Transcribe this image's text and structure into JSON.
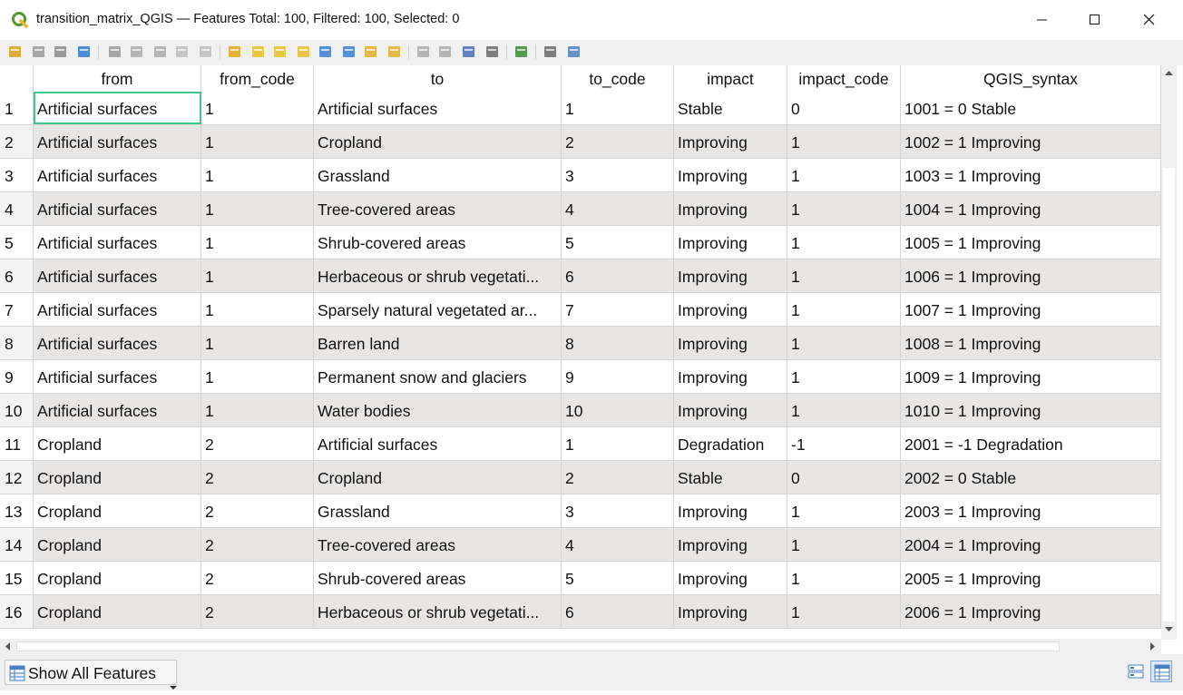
{
  "window": {
    "title": "transition_matrix_QGIS — Features Total: 100, Filtered: 100, Selected: 0",
    "app_icon": "qgis-logo-icon",
    "controls": [
      "minimize-icon",
      "maximize-icon",
      "close-icon"
    ]
  },
  "toolbar": {
    "icons": [
      "toggle-editing-icon",
      "toggle-multi-edit-icon",
      "save-edits-icon",
      "reload-table-icon",
      "add-feature-icon",
      "delete-selected-icon",
      "cut-icon",
      "copy-icon",
      "paste-icon",
      "expression-select-icon",
      "select-all-icon",
      "invert-selection-icon",
      "deselect-all-icon",
      "filter-select-icon",
      "move-selection-to-top-icon",
      "pan-to-selected-icon",
      "zoom-to-selected-icon",
      "new-field-icon",
      "delete-field-icon",
      "field-calculator-icon",
      "conditional-formatting-icon",
      "dock-table-icon",
      "actions-icon",
      "zoom-to-feature-icon"
    ]
  },
  "table": {
    "columns": [
      "from",
      "from_code",
      "to",
      "to_code",
      "impact",
      "impact_code",
      "QGIS_syntax"
    ],
    "rows": [
      {
        "n": "1",
        "from": "Artificial surfaces",
        "from_code": "1",
        "to": "Artificial surfaces",
        "to_code": "1",
        "impact": "Stable",
        "impact_code": "0",
        "syntax": "1001 = 0 Stable"
      },
      {
        "n": "2",
        "from": "Artificial surfaces",
        "from_code": "1",
        "to": "Cropland",
        "to_code": "2",
        "impact": "Improving",
        "impact_code": "1",
        "syntax": "1002 = 1 Improving"
      },
      {
        "n": "3",
        "from": "Artificial surfaces",
        "from_code": "1",
        "to": "Grassland",
        "to_code": "3",
        "impact": "Improving",
        "impact_code": "1",
        "syntax": "1003 = 1 Improving"
      },
      {
        "n": "4",
        "from": "Artificial surfaces",
        "from_code": "1",
        "to": "Tree-covered areas",
        "to_code": "4",
        "impact": "Improving",
        "impact_code": "1",
        "syntax": "1004 = 1 Improving"
      },
      {
        "n": "5",
        "from": "Artificial surfaces",
        "from_code": "1",
        "to": "Shrub-covered areas",
        "to_code": "5",
        "impact": "Improving",
        "impact_code": "1",
        "syntax": "1005 = 1 Improving"
      },
      {
        "n": "6",
        "from": "Artificial surfaces",
        "from_code": "1",
        "to": "Herbaceous or shrub vegetati...",
        "to_code": "6",
        "impact": "Improving",
        "impact_code": "1",
        "syntax": "1006 = 1 Improving"
      },
      {
        "n": "7",
        "from": "Artificial surfaces",
        "from_code": "1",
        "to": "Sparsely natural vegetated ar...",
        "to_code": "7",
        "impact": "Improving",
        "impact_code": "1",
        "syntax": "1007 = 1 Improving"
      },
      {
        "n": "8",
        "from": "Artificial surfaces",
        "from_code": "1",
        "to": "Barren land",
        "to_code": "8",
        "impact": "Improving",
        "impact_code": "1",
        "syntax": "1008 = 1 Improving"
      },
      {
        "n": "9",
        "from": "Artificial surfaces",
        "from_code": "1",
        "to": "Permanent snow and glaciers",
        "to_code": "9",
        "impact": "Improving",
        "impact_code": "1",
        "syntax": "1009 = 1 Improving"
      },
      {
        "n": "10",
        "from": "Artificial surfaces",
        "from_code": "1",
        "to": "Water bodies",
        "to_code": "10",
        "impact": "Improving",
        "impact_code": "1",
        "syntax": "1010 = 1 Improving"
      },
      {
        "n": "11",
        "from": "Cropland",
        "from_code": "2",
        "to": "Artificial surfaces",
        "to_code": "1",
        "impact": "Degradation",
        "impact_code": "-1",
        "syntax": "2001 = -1 Degradation"
      },
      {
        "n": "12",
        "from": "Cropland",
        "from_code": "2",
        "to": "Cropland",
        "to_code": "2",
        "impact": "Stable",
        "impact_code": "0",
        "syntax": "2002 = 0 Stable"
      },
      {
        "n": "13",
        "from": "Cropland",
        "from_code": "2",
        "to": "Grassland",
        "to_code": "3",
        "impact": "Improving",
        "impact_code": "1",
        "syntax": "2003 = 1 Improving"
      },
      {
        "n": "14",
        "from": "Cropland",
        "from_code": "2",
        "to": "Tree-covered areas",
        "to_code": "4",
        "impact": "Improving",
        "impact_code": "1",
        "syntax": "2004 = 1 Improving"
      },
      {
        "n": "15",
        "from": "Cropland",
        "from_code": "2",
        "to": "Shrub-covered areas",
        "to_code": "5",
        "impact": "Improving",
        "impact_code": "1",
        "syntax": "2005 = 1 Improving"
      },
      {
        "n": "16",
        "from": "Cropland",
        "from_code": "2",
        "to": "Herbaceous or shrub vegetati...",
        "to_code": "6",
        "impact": "Improving",
        "impact_code": "1",
        "syntax": "2006 = 1 Improving"
      }
    ],
    "selected_cell": {
      "row": 0,
      "column": "from"
    },
    "row_colors": {
      "plain": "#ffffff",
      "alt": "#e8e6e4"
    },
    "selection_color": "#3dc98a"
  },
  "bottom": {
    "show_all_label": "Show All Features",
    "show_all_icon": "attribute-table-icon",
    "view_buttons": [
      "form-view-icon",
      "table-view-icon"
    ]
  }
}
